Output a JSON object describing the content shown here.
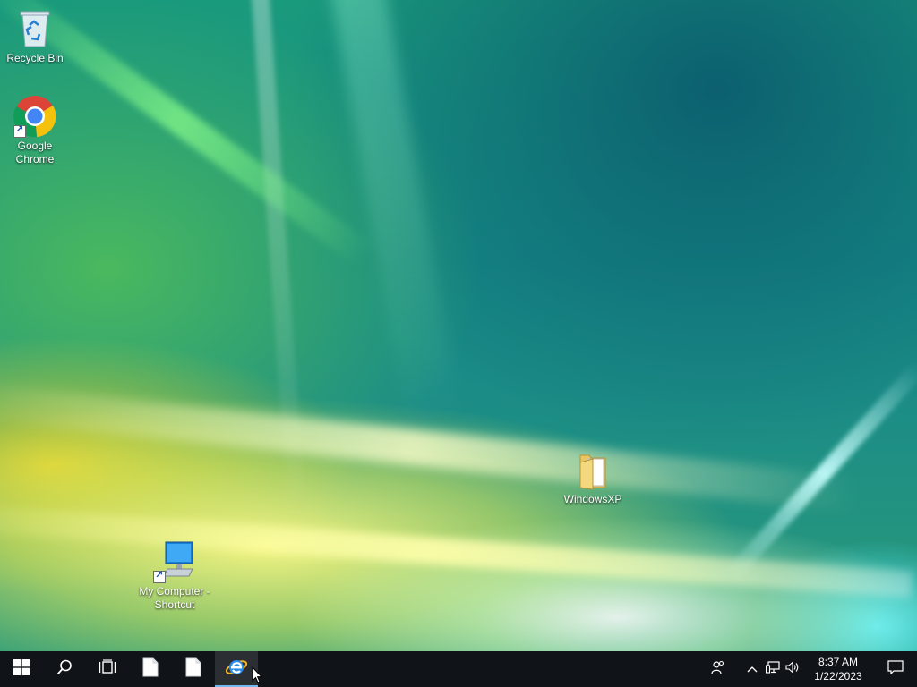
{
  "desktop": {
    "icons": [
      {
        "label": "Recycle Bin",
        "icon": "recycle-bin-icon"
      },
      {
        "label": "Google Chrome",
        "icon": "chrome-icon"
      },
      {
        "label": "WindowsXP",
        "icon": "folder-icon"
      },
      {
        "label": "My Computer - Shortcut",
        "icon": "computer-icon"
      }
    ]
  },
  "taskbar": {
    "buttons": [
      {
        "icon": "windows-start-icon"
      },
      {
        "icon": "search-icon"
      },
      {
        "icon": "task-view-icon"
      },
      {
        "icon": "document-icon"
      },
      {
        "icon": "document-icon"
      },
      {
        "icon": "internet-explorer-icon"
      }
    ],
    "tray": {
      "icons": [
        "people-icon",
        "chevron-up-icon",
        "network-icon",
        "speaker-icon"
      ],
      "time": "8:37 AM",
      "date": "1/22/2023",
      "notification_icon": "action-center-icon"
    }
  },
  "colors": {
    "taskbar_bg": "#101418",
    "accent": "#76b9ed"
  }
}
